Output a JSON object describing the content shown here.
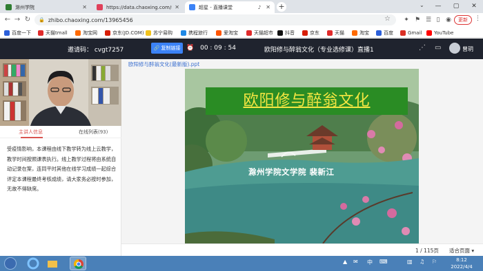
{
  "browser": {
    "tabs": [
      {
        "title": "滁州学院",
        "favicon_color": "#2f7d32"
      },
      {
        "title": "https://data.chaoxing.com/sta",
        "favicon_color": "#e0405a"
      },
      {
        "title": "超星 - 直播课堂",
        "favicon_color": "#3b82f6"
      }
    ],
    "new_tab": "+",
    "address": "zhibo.chaoxing.com/13965456",
    "update_label": "更新",
    "bookmarks": [
      {
        "label": "百度一下",
        "color": "#2b5fd9"
      },
      {
        "label": "天猫tmall",
        "color": "#e02b2b"
      },
      {
        "label": "淘宝网",
        "color": "#ff6a00"
      },
      {
        "label": "京东(JD.COM)",
        "color": "#d81e06"
      },
      {
        "label": "苏宁易购",
        "color": "#f2c21b"
      },
      {
        "label": "携程旅行",
        "color": "#1e88e5"
      },
      {
        "label": "爱淘宝",
        "color": "#ff5500"
      },
      {
        "label": "天猫超市",
        "color": "#e02b2b"
      },
      {
        "label": "抖音",
        "color": "#111111"
      },
      {
        "label": "京东",
        "color": "#d81e06"
      },
      {
        "label": "天猫",
        "color": "#e02b2b"
      },
      {
        "label": "淘宝",
        "color": "#ff6a00"
      },
      {
        "label": "百度",
        "color": "#2b5fd9"
      },
      {
        "label": "Gmail",
        "color": "#d93025"
      },
      {
        "label": "YouTube",
        "color": "#ff0000"
      }
    ]
  },
  "header": {
    "invite_code": "邀请码： cvgt7257",
    "copy_link_label": "复制链接",
    "elapsed": "00 : 09 : 54",
    "course_title": "欧阳修与醉翁文化（专业选修课）直播1",
    "user_name": "曾玥"
  },
  "sidebar": {
    "tab_host": "主讲人信息",
    "tab_online": "在线列表(93)",
    "notice": "受疫情影响，本课程由线下教学转为线上云教学，教学时间按照课表执行。线上教学过程将由系统自动记录在案，连同平时其他在线学习成绩一起综合评定本课程最终考核成绩，请大家务必按时参加，无故不得缺席。"
  },
  "main": {
    "file_name": "欧阳修与醉翁文化(最新版).ppt",
    "slide_title": "欧阳修与醉翁文化",
    "slide_author": "滁州学院文学院  裴新江",
    "page_current": "1",
    "page_total": "/  115页",
    "fit_mode": "适合页面 ▾"
  },
  "taskbar": {
    "time": "8:12",
    "date": "2022/4/4"
  },
  "colors": {
    "header_bg": "#1f232e",
    "accent_blue": "#3b82f6",
    "tab_accent": "#d9534f",
    "slide_title_bg": "#2a8c24",
    "slide_title_text": "#f5e642"
  }
}
